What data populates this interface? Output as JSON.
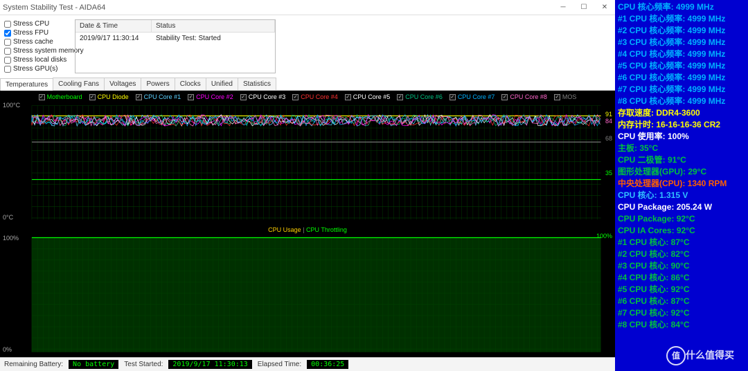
{
  "window": {
    "title": "System Stability Test - AIDA64"
  },
  "stress": [
    {
      "label": "Stress CPU",
      "checked": false
    },
    {
      "label": "Stress FPU",
      "checked": true
    },
    {
      "label": "Stress cache",
      "checked": false
    },
    {
      "label": "Stress system memory",
      "checked": false
    },
    {
      "label": "Stress local disks",
      "checked": false
    },
    {
      "label": "Stress GPU(s)",
      "checked": false
    }
  ],
  "log": {
    "hdr_dt": "Date & Time",
    "hdr_st": "Status",
    "row_dt": "2019/9/17 11:30:14",
    "row_st": "Stability Test: Started"
  },
  "tabs": [
    "Temperatures",
    "Cooling Fans",
    "Voltages",
    "Powers",
    "Clocks",
    "Unified",
    "Statistics"
  ],
  "active_tab": 0,
  "chart_data": [
    {
      "type": "line",
      "title": "",
      "ylabel_top": "100°C",
      "ylabel_bot": "0°C",
      "ylim": [
        0,
        100
      ],
      "legend": [
        {
          "name": "Motherboard",
          "color": "#00ff00"
        },
        {
          "name": "CPU Diode",
          "color": "#ffff00"
        },
        {
          "name": "CPU Core #1",
          "color": "#5ad0ff"
        },
        {
          "name": "CPU Core #2",
          "color": "#ff00ff"
        },
        {
          "name": "CPU Core #3",
          "color": "#ffffff"
        },
        {
          "name": "CPU Core #4",
          "color": "#ff3030"
        },
        {
          "name": "CPU Core #5",
          "color": "#ffffff"
        },
        {
          "name": "CPU Core #6",
          "color": "#00c080"
        },
        {
          "name": "CPU Core #7",
          "color": "#00b0ff"
        },
        {
          "name": "CPU Core #8",
          "color": "#ff66cc"
        },
        {
          "name": "MOS",
          "color": "#808080"
        }
      ],
      "right_labels": [
        {
          "text": "91",
          "color": "#ffff00",
          "y": 91
        },
        {
          "text": "84",
          "color": "#ff66cc",
          "y": 84
        },
        {
          "text": "68",
          "color": "#808080",
          "y": 68
        },
        {
          "text": "35",
          "color": "#00ff00",
          "y": 35
        }
      ],
      "series_approx": {
        "Motherboard": 35,
        "MOS": 68,
        "CPU Diode": 91,
        "CPU Cores avg": 86
      }
    },
    {
      "type": "line",
      "ylabel_top": "100%",
      "ylabel_bot": "0%",
      "ylim": [
        0,
        100
      ],
      "right_labels": [
        {
          "text": "100%",
          "color": "#00ff00",
          "y": 100
        }
      ],
      "legend_text": {
        "usage": "CPU Usage",
        "throt": "CPU Throttling",
        "sep": "  |  "
      },
      "colors": {
        "usage": "#ffd000",
        "throt": "#00ff00"
      },
      "series_approx": {
        "CPU Usage": 100,
        "CPU Throttling": 0
      }
    }
  ],
  "status": {
    "batt_label": "Remaining Battery:",
    "batt_val": "No battery",
    "start_label": "Test Started:",
    "start_val": "2019/9/17 11:30:13",
    "elapsed_label": "Elapsed Time:",
    "elapsed_val": "00:36:25"
  },
  "sidebar": [
    {
      "t": "CPU 核心频率: 4999 MHz",
      "c": "#00b0ff"
    },
    {
      "t": "#1 CPU 核心频率: 4999 MHz",
      "c": "#00b0ff"
    },
    {
      "t": "#2 CPU 核心频率: 4999 MHz",
      "c": "#00b0ff"
    },
    {
      "t": "#3 CPU 核心频率: 4999 MHz",
      "c": "#00b0ff"
    },
    {
      "t": "#4 CPU 核心频率: 4999 MHz",
      "c": "#00b0ff"
    },
    {
      "t": "#5 CPU 核心频率: 4999 MHz",
      "c": "#00b0ff"
    },
    {
      "t": "#6 CPU 核心频率: 4999 MHz",
      "c": "#00b0ff"
    },
    {
      "t": "#7 CPU 核心频率: 4999 MHz",
      "c": "#00b0ff"
    },
    {
      "t": "#8 CPU 核心频率: 4999 MHz",
      "c": "#00b0ff"
    },
    {
      "t": "存取速度: DDR4-3600",
      "c": "#ffff00"
    },
    {
      "t": "内存计时: 16-16-16-36 CR2",
      "c": "#ffff00"
    },
    {
      "t": "CPU 使用率: 100%",
      "c": "#ffffff"
    },
    {
      "t": "主板: 35°C",
      "c": "#00c040"
    },
    {
      "t": "CPU 二极管: 91°C",
      "c": "#00c040"
    },
    {
      "t": "图形处理器(GPU): 29°C",
      "c": "#00c040"
    },
    {
      "t": "中央处理器(CPU): 1340 RPM",
      "c": "#ff6000"
    },
    {
      "t": "CPU 核心: 1.315 V",
      "c": "#30c0ff"
    },
    {
      "t": "CPU Package: 205.24 W",
      "c": "#ffffff"
    },
    {
      "t": "CPU Package: 92°C",
      "c": "#00c040"
    },
    {
      "t": "CPU IA Cores: 92°C",
      "c": "#00c040"
    },
    {
      "t": " #1 CPU 核心: 87°C",
      "c": "#00c040"
    },
    {
      "t": " #2 CPU 核心: 82°C",
      "c": "#00c040"
    },
    {
      "t": " #3 CPU 核心: 90°C",
      "c": "#00c040"
    },
    {
      "t": " #4 CPU 核心: 86°C",
      "c": "#00c040"
    },
    {
      "t": " #5 CPU 核心: 92°C",
      "c": "#00c040"
    },
    {
      "t": " #6 CPU 核心: 87°C",
      "c": "#00c040"
    },
    {
      "t": " #7 CPU 核心: 92°C",
      "c": "#00c040"
    },
    {
      "t": " #8 CPU 核心: 84°C",
      "c": "#00c040"
    }
  ],
  "watermark": "什么值得买",
  "watermark_badge": "值"
}
